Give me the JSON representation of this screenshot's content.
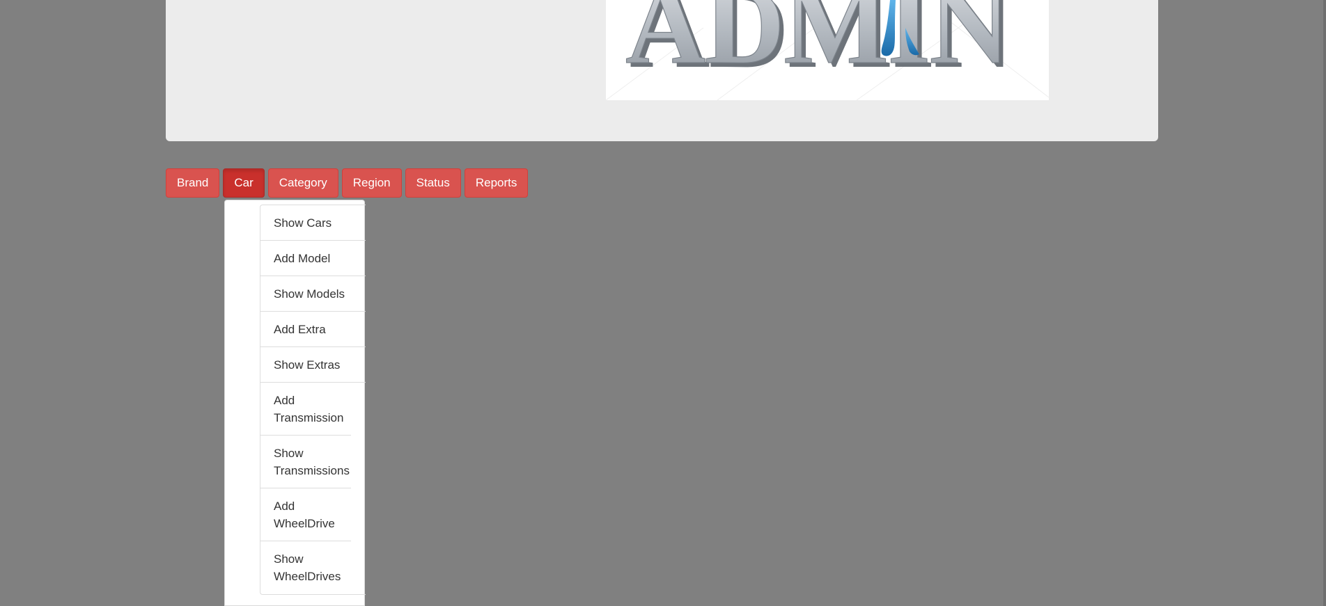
{
  "logo": {
    "text": "ADMIN",
    "alt": "ADMIN"
  },
  "nav": {
    "items": [
      {
        "label": "Brand",
        "active": false
      },
      {
        "label": "Car",
        "active": true
      },
      {
        "label": "Category",
        "active": false
      },
      {
        "label": "Region",
        "active": false
      },
      {
        "label": "Status",
        "active": false
      },
      {
        "label": "Reports",
        "active": false
      }
    ]
  },
  "dropdown": {
    "items": [
      {
        "label": "Show Cars"
      },
      {
        "label": "Add Model"
      },
      {
        "label": "Show Models"
      },
      {
        "label": "Add Extra"
      },
      {
        "label": "Show Extras"
      },
      {
        "label": "Add Transmission"
      },
      {
        "label": "Show Transmissions"
      },
      {
        "label": "Add WheelDrive"
      },
      {
        "label": "Show WheelDrives"
      }
    ]
  },
  "colors": {
    "page_background": "#808080",
    "hero_background": "#ececec",
    "button_danger": "#d9534f",
    "button_danger_active": "#c9302c",
    "dropdown_background": "#ffffff",
    "logo_letters": "#b9bec4",
    "logo_accent": "#1f7fc0"
  }
}
